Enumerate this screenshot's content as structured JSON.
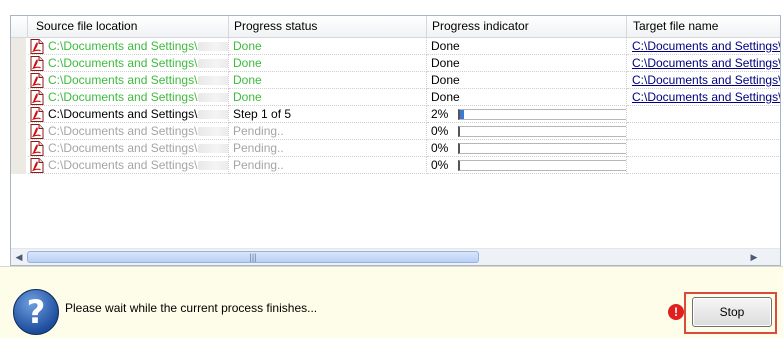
{
  "columns": [
    "Source file location",
    "Progress status",
    "Progress indicator",
    "Target file name"
  ],
  "rows": [
    {
      "state": "done",
      "source": "C:\\Documents and Settings\\",
      "status": "Done",
      "indicator": "Done",
      "target": "C:\\Documents and Settings\\"
    },
    {
      "state": "done",
      "source": "C:\\Documents and Settings\\",
      "status": "Done",
      "indicator": "Done",
      "target": "C:\\Documents and Settings\\"
    },
    {
      "state": "done",
      "source": "C:\\Documents and Settings\\",
      "status": "Done",
      "indicator": "Done",
      "target": "C:\\Documents and Settings\\"
    },
    {
      "state": "done",
      "source": "C:\\Documents and Settings\\",
      "status": "Done",
      "indicator": "Done",
      "target": "C:\\Documents and Settings\\"
    },
    {
      "state": "active",
      "source": "C:\\Documents and Settings\\",
      "status": "Step 1 of 5",
      "progress": 2,
      "indicator": "2%",
      "target": ""
    },
    {
      "state": "pending",
      "source": "C:\\Documents and Settings\\",
      "status": "Pending..",
      "progress": 0,
      "indicator": "0%",
      "target": ""
    },
    {
      "state": "pending",
      "source": "C:\\Documents and Settings\\",
      "status": "Pending..",
      "progress": 0,
      "indicator": "0%",
      "target": ""
    },
    {
      "state": "pending",
      "source": "C:\\Documents and Settings\\",
      "status": "Pending..",
      "progress": 0,
      "indicator": "0%",
      "target": ""
    }
  ],
  "scrollbar": {
    "left_arrow": "◀",
    "right_arrow": "▶",
    "thumb_grip": "|||"
  },
  "bottom": {
    "help_icon": "?",
    "message": "Please wait while the current process finishes...",
    "stop_label": "Stop",
    "badge": "!"
  },
  "colors": {
    "done_text": "#3dbb3d",
    "pending_text": "#a5a5a5",
    "link": "#000080",
    "progress_fill": "#3b7bd6",
    "highlight": "#d94b3b",
    "bottom_bg": "#fdfde9"
  }
}
